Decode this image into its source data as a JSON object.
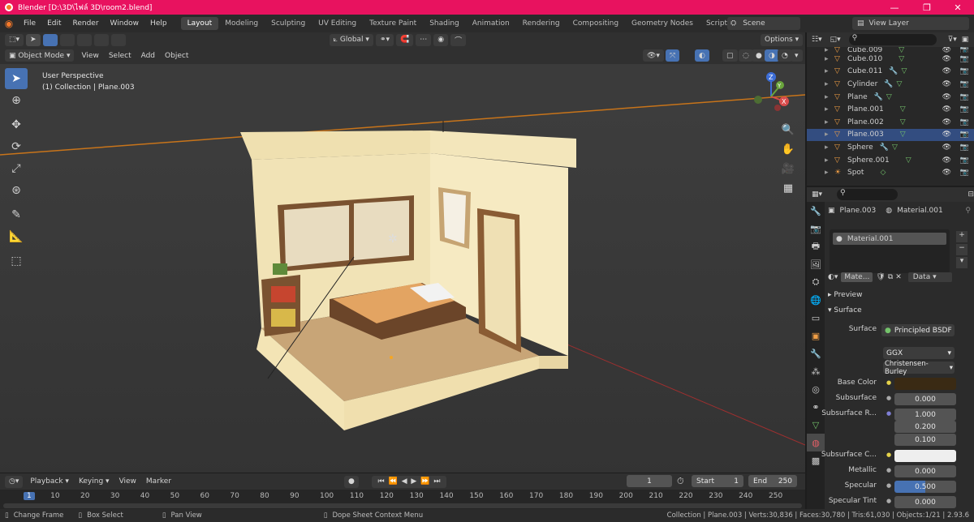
{
  "window": {
    "title": "Blender [D:\\3D\\ไฟล์ 3D\\room2.blend]",
    "controls": [
      "—",
      "❐",
      "✕"
    ]
  },
  "menu": [
    "File",
    "Edit",
    "Render",
    "Window",
    "Help"
  ],
  "workspaces": [
    "Layout",
    "Modeling",
    "Sculpting",
    "UV Editing",
    "Texture Paint",
    "Shading",
    "Animation",
    "Rendering",
    "Compositing",
    "Geometry Nodes",
    "Scripting",
    "+"
  ],
  "scene": {
    "name": "Scene",
    "view_layer": "View Layer"
  },
  "viewport": {
    "orientation": "Global",
    "options": "Options",
    "mode": "Object Mode",
    "menus": [
      "View",
      "Select",
      "Add",
      "Object"
    ],
    "info_line1": "User Perspective",
    "info_line2": "(1) Collection | Plane.003"
  },
  "outliner": {
    "items": [
      {
        "name": "Cube.009",
        "mod": false
      },
      {
        "name": "Cube.010",
        "mod": false
      },
      {
        "name": "Cube.011",
        "mod": true
      },
      {
        "name": "Cylinder",
        "mod": true
      },
      {
        "name": "Plane",
        "mod": true
      },
      {
        "name": "Plane.001",
        "mod": false
      },
      {
        "name": "Plane.002",
        "mod": false
      },
      {
        "name": "Plane.003",
        "mod": false,
        "selected": true
      },
      {
        "name": "Sphere",
        "mod": true
      },
      {
        "name": "Sphere.001",
        "mod": false
      },
      {
        "name": "Spot",
        "mod": false
      }
    ]
  },
  "properties": {
    "object": "Plane.003",
    "material": "Material.001",
    "slot": "Material.001",
    "mat_short": "Mate...",
    "link": "Data",
    "preview": "Preview",
    "surface": "Surface",
    "surface_label": "Surface",
    "surface_value": "Principled BSDF",
    "distribution": "GGX",
    "subsurface_method": "Christensen-Burley",
    "rows": [
      {
        "label": "Base Color",
        "value": ""
      },
      {
        "label": "Subsurface",
        "value": "0.000"
      },
      {
        "label": "Subsurface R...",
        "value": "1.000"
      },
      {
        "label": "",
        "value": "0.200"
      },
      {
        "label": "",
        "value": "0.100"
      },
      {
        "label": "Subsurface C...",
        "value": ""
      },
      {
        "label": "Metallic",
        "value": "0.000"
      },
      {
        "label": "Specular",
        "value": "0.500"
      },
      {
        "label": "Specular Tint",
        "value": "0.000"
      }
    ],
    "specular_fill": 0.5
  },
  "timeline": {
    "menus": [
      "Playback",
      "Keying",
      "View",
      "Marker"
    ],
    "current": "1",
    "start_label": "Start",
    "start": "1",
    "end_label": "End",
    "end": "250",
    "ticks": [
      "1",
      "10",
      "20",
      "30",
      "40",
      "50",
      "60",
      "70",
      "80",
      "90",
      "100",
      "110",
      "120",
      "130",
      "140",
      "150",
      "160",
      "170",
      "180",
      "190",
      "200",
      "210",
      "220",
      "230",
      "240",
      "250"
    ]
  },
  "status": {
    "left1": "Change Frame",
    "left2": "Box Select",
    "left3": "Pan View",
    "center": "Dope Sheet Context Menu",
    "right": "Collection | Plane.003 | Verts:30,836 | Faces:30,780 | Tris:61,030 | Objects:1/21 | 2.93.6"
  },
  "colors": {
    "titlebar": "#e8125f",
    "accent": "#4772b3",
    "base_color": "#3a2a14",
    "subsurface_color": "#eeeeee"
  }
}
